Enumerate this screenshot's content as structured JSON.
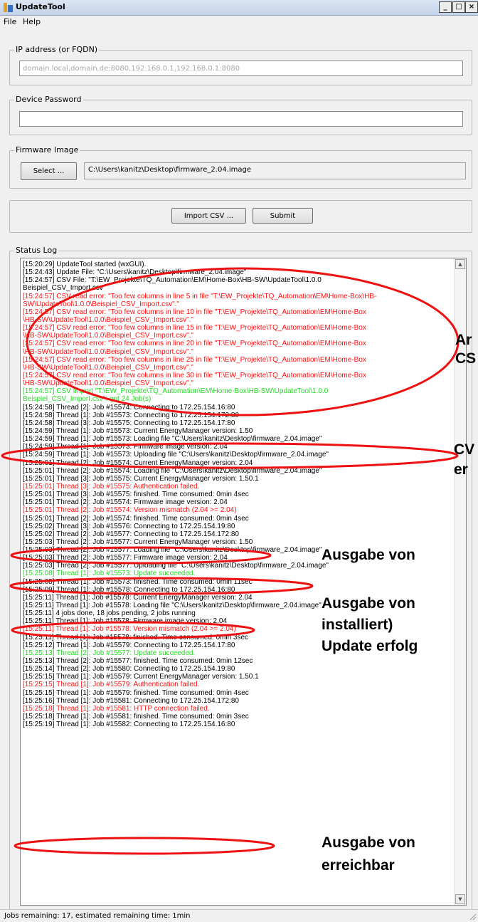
{
  "window": {
    "title": "UpdateTool",
    "minimize": "_",
    "maximize": "□",
    "close": "×"
  },
  "menu": {
    "file": "File",
    "help": "Help"
  },
  "ip": {
    "label": "IP address (or FQDN)",
    "value": "",
    "placeholder": "domain.local,domain.de:8080,192.168.0.1,192.168.0.1:8080"
  },
  "password": {
    "label": "Device Password",
    "value": ""
  },
  "firmware": {
    "label": "Firmware Image",
    "select_label": "Select ...",
    "path": "C:\\Users\\kanitz\\Desktop\\firmware_2.04.image"
  },
  "actions": {
    "import_csv": "Import CSV ...",
    "submit": "Submit"
  },
  "log": {
    "label": "Status Log",
    "lines": [
      {
        "t": "[15:20:29] UpdateTool started (wxGUI).",
        "c": "black"
      },
      {
        "t": "[15:24:43] Update File: \"C:\\Users\\kanitz\\Desktop\\firmware_2.04.image\"",
        "c": "black"
      },
      {
        "t": "[15:24:57] CSV File: \"T:\\EW_Projekte\\TQ_Automation\\EM\\Home-Box\\HB-SW\\UpdateTool\\1.0.0",
        "c": "black"
      },
      {
        "t": "Beispiel_CSV_Import.csv\"",
        "c": "black"
      },
      {
        "t": "[15:24:57] CSV read error: \"Too few columns in line 5 in file \"T:\\EW_Projekte\\TQ_Automation\\EM\\Home-Box\\HB-",
        "c": "red"
      },
      {
        "t": "SW\\UpdateTool\\1.0.0\\Beispiel_CSV_Import.csv\".\"",
        "c": "red"
      },
      {
        "t": "[15:24:57] CSV read error: \"Too few columns in line 10 in file \"T:\\EW_Projekte\\TQ_Automation\\EM\\Home-Box",
        "c": "red"
      },
      {
        "t": "\\HB-SW\\UpdateTool\\1.0.0\\Beispiel_CSV_Import.csv\".\"",
        "c": "red"
      },
      {
        "t": "[15:24:57] CSV read error: \"Too few columns in line 15 in file \"T:\\EW_Projekte\\TQ_Automation\\EM\\Home-Box",
        "c": "red"
      },
      {
        "t": "\\HB-SW\\UpdateTool\\1.0.0\\Beispiel_CSV_Import.csv\".\"",
        "c": "red"
      },
      {
        "t": "[15:24:57] CSV read error: \"Too few columns in line 20 in file \"T:\\EW_Projekte\\TQ_Automation\\EM\\Home-Box",
        "c": "red"
      },
      {
        "t": "\\HB-SW\\UpdateTool\\1.0.0\\Beispiel_CSV_Import.csv\".\"",
        "c": "red"
      },
      {
        "t": "[15:24:57] CSV read error: \"Too few columns in line 25 in file \"T:\\EW_Projekte\\TQ_Automation\\EM\\Home-Box",
        "c": "red"
      },
      {
        "t": "\\HB-SW\\UpdateTool\\1.0.0\\Beispiel_CSV_Import.csv\".\"",
        "c": "red"
      },
      {
        "t": "[15:24:57] CSV read error: \"Too few columns in line 30 in file \"T:\\EW_Projekte\\TQ_Automation\\EM\\Home-Box",
        "c": "red"
      },
      {
        "t": "\\HB-SW\\UpdateTool\\1.0.0\\Beispiel_CSV_Import.csv\".\"",
        "c": "red"
      },
      {
        "t": "[15:24:57] CSV Import \"T:\\EW_Projekte\\TQ_Automation\\EM\\Home-Box\\HB-SW\\UpdateTool\\1.0.0",
        "c": "green"
      },
      {
        "t": "Beispiel_CSV_Import.csv\": got 24 Job(s)",
        "c": "green"
      },
      {
        "t": "[15:24:58] Thread [2]: Job #15574: Connecting to 172.25.154.16:80",
        "c": "black"
      },
      {
        "t": "[15:24:58] Thread [1]: Job #15573: Connecting to 172.25.154.172:80",
        "c": "black"
      },
      {
        "t": "[15:24:58] Thread [3]: Job #15575: Connecting to 172.25.154.17:80",
        "c": "black"
      },
      {
        "t": "[15:24:59] Thread [1]: Job #15573: Current EnergyManager version: 1.50",
        "c": "black"
      },
      {
        "t": "[15:24:59] Thread [1]: Job #15573: Loading file \"C:\\Users\\kanitz\\Desktop\\firmware_2.04.image\"",
        "c": "black"
      },
      {
        "t": "[15:24:59] Thread [1]: Job #15573: Firmware image version: 2.04",
        "c": "black"
      },
      {
        "t": "[15:24:59] Thread [1]: Job #15573: Uploading file \"C:\\Users\\kanitz\\Desktop\\firmware_2.04.image\"",
        "c": "black"
      },
      {
        "t": "[15:25:01] Thread [2]: Job #15574: Current EnergyManager version: 2.04",
        "c": "black"
      },
      {
        "t": "[15:25:01] Thread [2]: Job #15574: Loading file \"C:\\Users\\kanitz\\Desktop\\firmware_2.04.image\"",
        "c": "black"
      },
      {
        "t": "[15:25:01] Thread [3]: Job #15575: Current EnergyManager version: 1.50.1",
        "c": "black"
      },
      {
        "t": "[15:25:01] Thread [3]: Job #15575: Authentication failed.",
        "c": "red"
      },
      {
        "t": "[15:25:01] Thread [3]: Job #15575: finished. Time consumed: 0min 4sec",
        "c": "black"
      },
      {
        "t": "[15:25:01] Thread [2]: Job #15574: Firmware image version: 2.04",
        "c": "black"
      },
      {
        "t": "[15:25:01] Thread [2]: Job #15574: Version mismatch (2.04 >= 2.04)",
        "c": "red"
      },
      {
        "t": "[15:25:01] Thread [2]: Job #15574: finished. Time consumed: 0min 4sec",
        "c": "black"
      },
      {
        "t": "[15:25:02] Thread [3]: Job #15576: Connecting to 172.25.154.19:80",
        "c": "black"
      },
      {
        "t": "[15:25:02] Thread [2]: Job #15577: Connecting to 172.25.154.172:80",
        "c": "black"
      },
      {
        "t": "[15:25:03] Thread [2]: Job #15577: Current EnergyManager version: 1.50",
        "c": "black"
      },
      {
        "t": "[15:25:03] Thread [2]: Job #15577: Loading file \"C:\\Users\\kanitz\\Desktop\\firmware_2.04.image\"",
        "c": "black"
      },
      {
        "t": "[15:25:03] Thread [2]: Job #15577: Firmware image version: 2.04",
        "c": "black"
      },
      {
        "t": "[15:25:03] Thread [2]: Job #15577: Uploading file \"C:\\Users\\kanitz\\Desktop\\firmware_2.04.image\"",
        "c": "black"
      },
      {
        "t": "[15:25:08] Thread [1]: Job #15573: Update succeeded.",
        "c": "green"
      },
      {
        "t": "[15:25:08] Thread [1]: Job #15573: finished. Time consumed: 0min 11sec",
        "c": "black"
      },
      {
        "t": "[15:25:09] Thread [1]: Job #15578: Connecting to 172.25.154.16:80",
        "c": "black"
      },
      {
        "t": "[15:25:11] Thread [1]: Job #15578: Current EnergyManager version: 2.04",
        "c": "black"
      },
      {
        "t": "[15:25:11] Thread [1]: Job #15578: Loading file \"C:\\Users\\kanitz\\Desktop\\firmware_2.04.image\"",
        "c": "black"
      },
      {
        "t": "[15:25:11] 4 jobs done, 18 jobs pending, 2 jobs running",
        "c": "black"
      },
      {
        "t": "[15:25:11] Thread [1]: Job #15578: Firmware image version: 2.04",
        "c": "black"
      },
      {
        "t": "[15:25:11] Thread [1]: Job #15578: Version mismatch (2.04 >= 2.04)",
        "c": "red"
      },
      {
        "t": "[15:25:11] Thread [1]: Job #15578: finished. Time consumed: 0min 3sec",
        "c": "black"
      },
      {
        "t": "[15:25:12] Thread [1]: Job #15579: Connecting to 172.25.154.17:80",
        "c": "black"
      },
      {
        "t": "[15:25:13] Thread [2]: Job #15577: Update succeeded.",
        "c": "green"
      },
      {
        "t": "[15:25:13] Thread [2]: Job #15577: finished. Time consumed: 0min 12sec",
        "c": "black"
      },
      {
        "t": "[15:25:14] Thread [2]: Job #15580: Connecting to 172.25.154.19:80",
        "c": "black"
      },
      {
        "t": "[15:25:15] Thread [1]: Job #15579: Current EnergyManager version: 1.50.1",
        "c": "black"
      },
      {
        "t": "[15:25:15] Thread [1]: Job #15579: Authentication failed.",
        "c": "red"
      },
      {
        "t": "[15:25:15] Thread [1]: Job #15579: finished. Time consumed: 0min 4sec",
        "c": "black"
      },
      {
        "t": "[15:25:16] Thread [1]: Job #15581: Connecting to 172.25.154.172:80",
        "c": "black"
      },
      {
        "t": "[15:25:18] Thread [1]: Job #15581: HTTP connection failed.",
        "c": "red"
      },
      {
        "t": "[15:25:18] Thread [1]: Job #15581: finished. Time consumed: 0min 3sec",
        "c": "black"
      },
      {
        "t": "[15:25:19] Thread [1]: Job #15582: Connecting to 172.25.154.16:80",
        "c": "black"
      }
    ]
  },
  "annotations": [
    {
      "id": "csv-errors",
      "text": "Ar"
    },
    {
      "id": "csv-errors-2",
      "text": "CS"
    },
    {
      "id": "csv-import",
      "text": "CV"
    },
    {
      "id": "csv-import-2",
      "text": "er"
    },
    {
      "id": "auth-failed",
      "text": "Ausgabe von"
    },
    {
      "id": "version-mismatch",
      "text": "Ausgabe von"
    },
    {
      "id": "version-mismatch-2",
      "text": "installiert)"
    },
    {
      "id": "update-ok",
      "text": "Update erfolg"
    },
    {
      "id": "http-failed",
      "text": "Ausgabe von"
    },
    {
      "id": "http-failed-2",
      "text": "erreichbar"
    }
  ],
  "status": {
    "text": "Jobs remaining: 17, estimated remaining time: 1min"
  },
  "colors": {
    "error": "#ff1010",
    "success": "#22dd22",
    "highlight": "#ee1111"
  },
  "icons": [
    "app-icon",
    "scroll-up-icon",
    "scroll-down-icon",
    "resize-grip-icon"
  ]
}
